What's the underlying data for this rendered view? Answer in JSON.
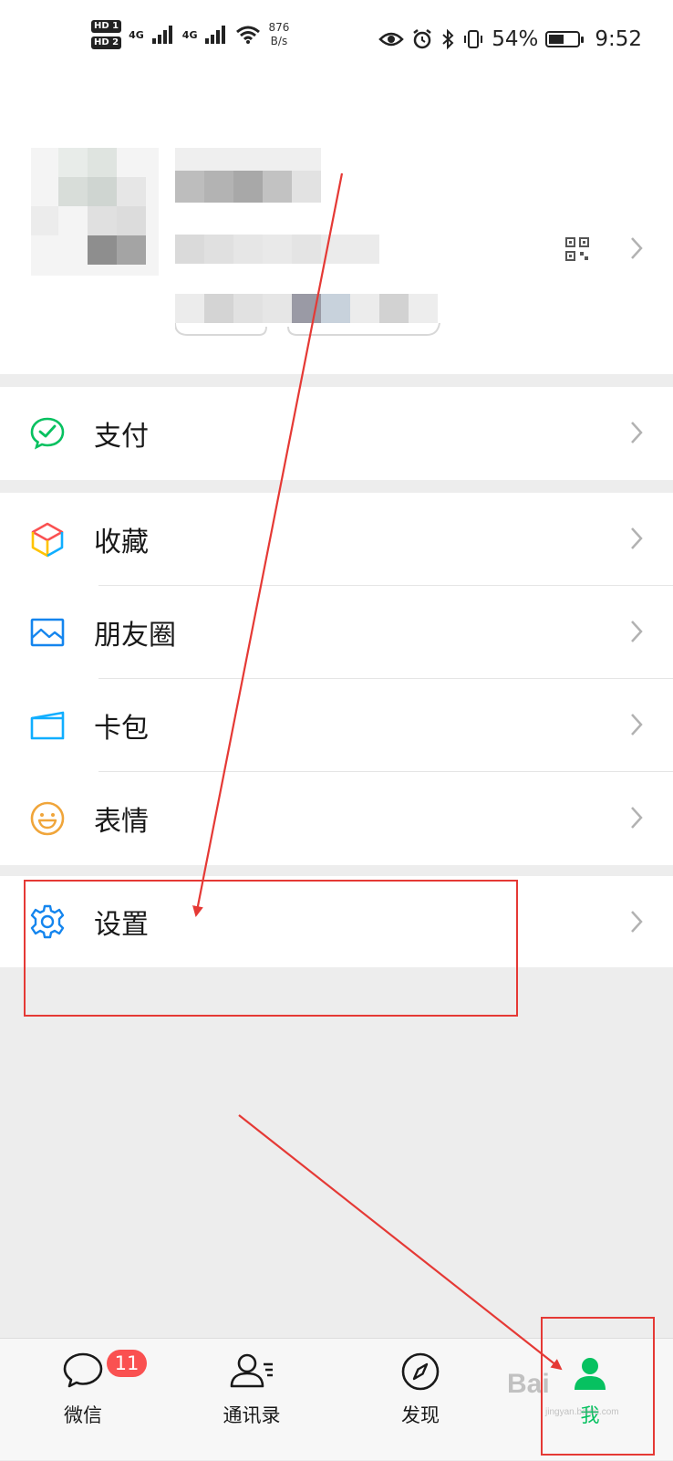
{
  "status_bar": {
    "sim1": "HD 1",
    "sim2": "HD 2",
    "signal1": "4G",
    "signal2": "4G",
    "net_speed": "876",
    "net_unit": "B/s",
    "battery_percent": "54%",
    "battery_level": 0.54,
    "time": "9:52",
    "icons": [
      "eye-comfort-icon",
      "alarm-icon",
      "bluetooth-icon",
      "vibrate-icon"
    ]
  },
  "profile": {
    "blurred": true,
    "qr_icon": "qr-code-icon",
    "chevron": "chevron-right-icon"
  },
  "menu": {
    "pay": {
      "label": "支付",
      "icon": "pay-icon"
    },
    "group2": [
      {
        "label": "收藏",
        "icon": "favorites-icon"
      },
      {
        "label": "朋友圈",
        "icon": "moments-icon"
      },
      {
        "label": "卡包",
        "icon": "card-wallet-icon"
      },
      {
        "label": "表情",
        "icon": "sticker-icon"
      }
    ],
    "settings": {
      "label": "设置",
      "icon": "settings-gear-icon"
    }
  },
  "tabbar": {
    "tabs": [
      {
        "label": "微信",
        "icon": "chat-icon",
        "badge": "11"
      },
      {
        "label": "通讯录",
        "icon": "contacts-icon"
      },
      {
        "label": "发现",
        "icon": "discover-compass-icon"
      },
      {
        "label": "我",
        "icon": "me-person-icon",
        "active": true
      }
    ]
  },
  "colors": {
    "accent_green": "#07c160",
    "badge_red": "#fa5151",
    "annotation_red": "#e53935",
    "background": "#ededed"
  },
  "watermark": {
    "text": "Bai",
    "url": "jingyan.baidu.com"
  }
}
